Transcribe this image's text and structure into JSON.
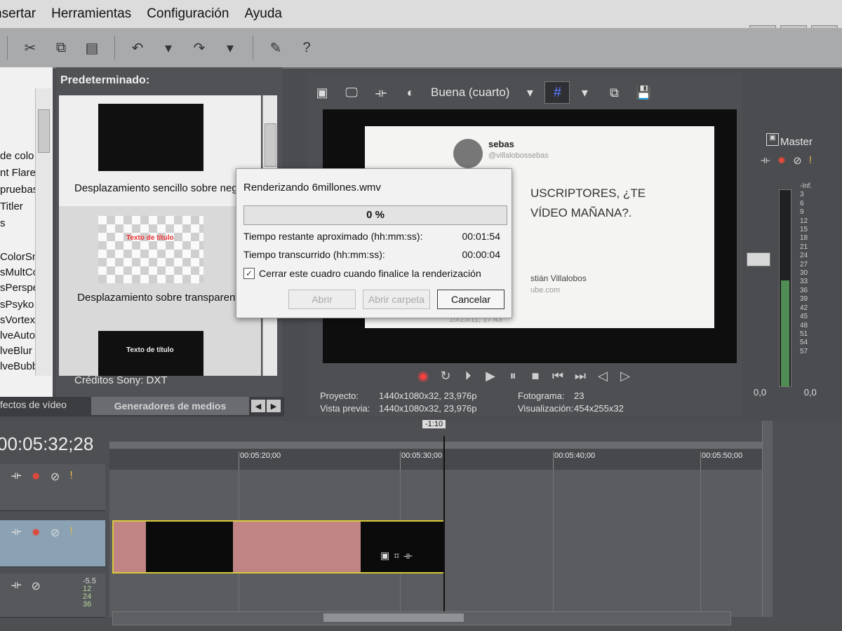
{
  "menu": [
    "nsertar",
    "Herramientas",
    "Configuración",
    "Ayuda"
  ],
  "window_buttons": [
    "▭",
    "❐",
    "✕"
  ],
  "left_panel": {
    "items": [
      "de colo",
      "nt Flares",
      "pruebas",
      "Titler",
      "s",
      "ColorSmo",
      "sMultColo",
      "sPerspect",
      "sPsyko",
      "sVortex",
      "lveAutoPa",
      "lveBlur",
      "lveBubble"
    ]
  },
  "generators": {
    "title": "Predeterminado:",
    "items": [
      {
        "label": "Desplazamiento sencillo sobre negro"
      },
      {
        "label": "Desplazamiento sobre transparente"
      },
      {
        "label": ""
      }
    ],
    "thumb_text": [
      "Texto de título",
      "Texto de título"
    ],
    "footer": "Créditos Sony: DXT"
  },
  "tabs": {
    "inactive": "fectos de vídeo",
    "active": "Generadores de medios"
  },
  "preview": {
    "quality": "Buena (cuarto)",
    "tweet": {
      "name": "sebas",
      "handle": "@villalobossebas",
      "line1": "USCRIPTORES, ¿TE",
      "line2": "VÍDEO MAÑANA?.",
      "line3": "stián Villalobos",
      "line4": "ube.com",
      "time": "10/23/11, 17:43"
    },
    "info": {
      "proyecto_label": "Proyecto:",
      "proyecto_value": "1440x1080x32, 23,976p",
      "vista_label": "Vista previa:",
      "vista_value": "1440x1080x32, 23,976p",
      "fotograma_label": "Fotograma:",
      "fotograma_value": "23",
      "visualizacion_label": "Visualización:",
      "visualizacion_value": "454x255x32"
    }
  },
  "master": {
    "label": "Master",
    "scale": [
      "-Inf.",
      "3",
      "6",
      "9",
      "12",
      "15",
      "18",
      "21",
      "24",
      "27",
      "30",
      "33",
      "36",
      "39",
      "42",
      "45",
      "48",
      "51",
      "54",
      "57"
    ],
    "val_left": "0,0",
    "val_right": "0,0",
    "meter_level": 0.54
  },
  "timeline": {
    "timecode": "00:05:32;28",
    "cursor_label": "-1:10",
    "ticks": [
      "00:05:20;00",
      "00:05:30;00",
      "00:05:40;00",
      "00:05:50;00"
    ],
    "audio_vals": [
      "-5.5",
      "12",
      "24",
      "36"
    ]
  },
  "render_dialog": {
    "title": "Renderizando 6millones.wmv",
    "progress_percent": 0,
    "progress_text": "0 %",
    "remaining_label": "Tiempo restante aproximado (hh:mm:ss):",
    "remaining_value": "00:01:54",
    "elapsed_label": "Tiempo transcurrido (hh:mm:ss):",
    "elapsed_value": "00:00:04",
    "close_checkbox_label": "Cerrar este cuadro cuando finalice la renderización",
    "close_checkbox_checked": true,
    "buttons": {
      "open": "Abrir",
      "open_folder": "Abrir carpeta",
      "cancel": "Cancelar"
    }
  }
}
